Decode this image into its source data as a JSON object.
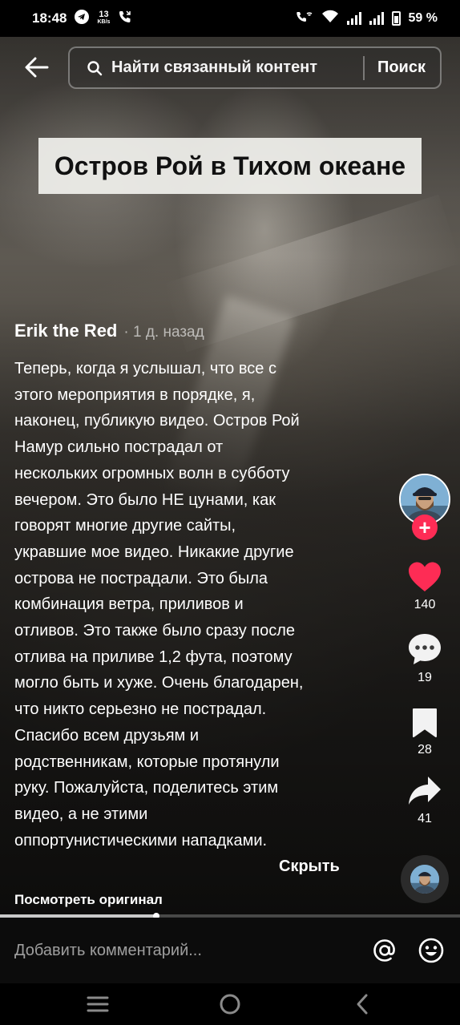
{
  "status_bar": {
    "time": "18:48",
    "net_speed_value": "13",
    "net_speed_unit": "KB/s",
    "battery_percent": "59 %"
  },
  "search": {
    "placeholder": "Найти связанный контент",
    "button_label": "Поиск"
  },
  "video": {
    "title_overlay": "Остров Рой в Тихом океане",
    "progress_fraction": 0.34
  },
  "post": {
    "author": "Erik the Red",
    "time_ago": "· 1 д. назад",
    "caption": "Теперь, когда я услышал, что все с\nэтого мероприятия в порядке, я,\nнаконец, публикую видео. Остров Рой\nНамур сильно пострадал от\nнескольких огромных волн в субботу\nвечером. Это было НЕ цунами, как\nговорят многие другие сайты,\nукравшие мое видео. Никакие другие\nострова не пострадали. Это была\nкомбинация ветра, приливов и\nотливов. Это также было сразу после\nотлива на приливе 1,2 фута, поэтому\nмогло быть и хуже. Очень благодарен,\nчто никто серьезно не пострадал.\nСпасибо всем друзьям и\nродственникам, которые протянули\nруку. Пожалуйста, поделитесь этим\nвидео, а не этими\nоппортунистическими нападками.",
    "hide_label": "Скрыть",
    "view_original_label": "Посмотреть оригинал"
  },
  "actions": {
    "likes": "140",
    "comments": "19",
    "bookmarks": "28",
    "shares": "41",
    "like_color": "#fe2c55"
  },
  "comment_bar": {
    "placeholder": "Добавить комментарий..."
  }
}
